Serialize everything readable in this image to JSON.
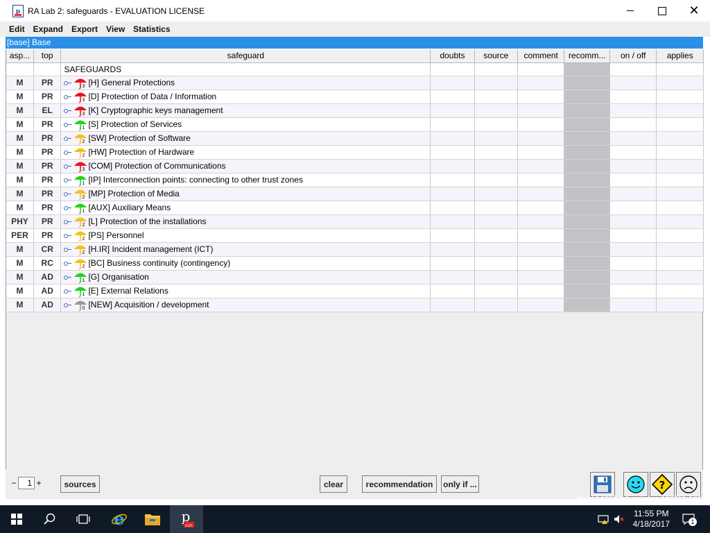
{
  "window": {
    "title": "RA Lab 2: safeguards - EVALUATION LICENSE"
  },
  "menu": [
    "Edit",
    "Expand",
    "Export",
    "View",
    "Statistics"
  ],
  "path": "[base] Base",
  "table": {
    "headers": {
      "asp": "asp...",
      "top": "top",
      "safeguard": "safeguard",
      "doubts": "doubts",
      "source": "source",
      "comment": "comment",
      "recomm": "recomm...",
      "onoff": "on / off",
      "applies": "applies"
    },
    "root_label": "SAFEGUARDS",
    "rows": [
      {
        "asp": "M",
        "top": "PR",
        "label": "[H] General Protections",
        "color": "#e8151b",
        "level": "3"
      },
      {
        "asp": "M",
        "top": "PR",
        "label": "[D] Protection of Data / Information",
        "color": "#e8151b",
        "level": "3"
      },
      {
        "asp": "M",
        "top": "EL",
        "label": "[K] Cryptographic keys management",
        "color": "#e8151b",
        "level": "3"
      },
      {
        "asp": "M",
        "top": "PR",
        "label": "[S] Protection of Services",
        "color": "#21d321",
        "level": "1"
      },
      {
        "asp": "M",
        "top": "PR",
        "label": "[SW] Protection of Software",
        "color": "#f5c21a",
        "level": "2"
      },
      {
        "asp": "M",
        "top": "PR",
        "label": "[HW] Protection of Hardware",
        "color": "#f5c21a",
        "level": "2"
      },
      {
        "asp": "M",
        "top": "PR",
        "label": "[COM] Protection of Communications",
        "color": "#e8151b",
        "level": "3"
      },
      {
        "asp": "M",
        "top": "PR",
        "label": "[IP] Interconnection points: connecting to other trust zones",
        "color": "#21d321",
        "level": "1"
      },
      {
        "asp": "M",
        "top": "PR",
        "label": "[MP] Protection of Media",
        "color": "#f5c21a",
        "level": "2"
      },
      {
        "asp": "M",
        "top": "PR",
        "label": "[AUX] Auxiliary Means",
        "color": "#21d321",
        "level": "1"
      },
      {
        "asp": "PHY",
        "top": "PR",
        "label": "[L] Protection of the installations",
        "color": "#f5c21a",
        "level": "2"
      },
      {
        "asp": "PER",
        "top": "PR",
        "label": "[PS] Personnel",
        "color": "#f5c21a",
        "level": "2"
      },
      {
        "asp": "M",
        "top": "CR",
        "label": "[H.IR] Incident management (ICT)",
        "color": "#f5c21a",
        "level": "2"
      },
      {
        "asp": "M",
        "top": "RC",
        "label": "[BC] Business continuity (contingency)",
        "color": "#f5c21a",
        "level": "2"
      },
      {
        "asp": "M",
        "top": "AD",
        "label": "[G] Organisation",
        "color": "#21d321",
        "level": "1"
      },
      {
        "asp": "M",
        "top": "AD",
        "label": "[E] External Relations",
        "color": "#21d321",
        "level": "1"
      },
      {
        "asp": "M",
        "top": "AD",
        "label": "[NEW] Acquisition / development",
        "color": "#999999",
        "level": "0"
      }
    ]
  },
  "bottom": {
    "minus": "−",
    "level_value": "1",
    "plus": "+",
    "sources": "sources",
    "clear": "clear",
    "recommendation": "recommendation",
    "only_if": "only if ..."
  },
  "build_text": "Build 14393.rs1_release.160715-1616",
  "taskbar": {
    "time": "11:55 PM",
    "date": "4/18/2017",
    "notifications": "1"
  },
  "icons": {
    "save": "floppy-disk-icon",
    "happy": "smiley-icon",
    "question": "question-diamond-icon",
    "sad": "sad-face-icon"
  }
}
